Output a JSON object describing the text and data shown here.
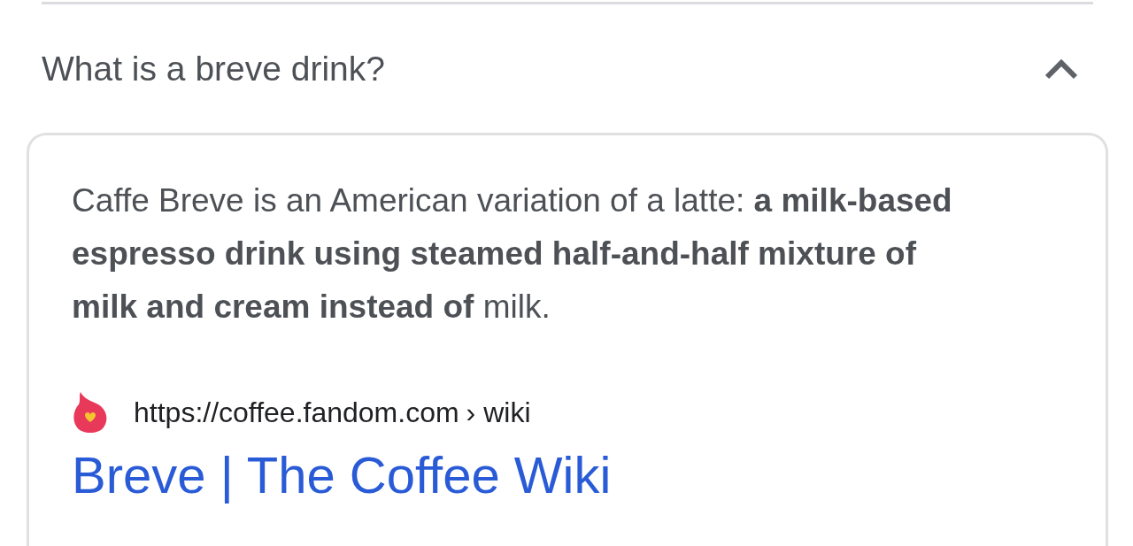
{
  "question": {
    "text": "What is a breve drink?",
    "expanded": true
  },
  "answer": {
    "snippet": "Caffe Breve is an American variation of a latte: **a milk-based espresso drink using steamed half-and-half mixture of milk and cream instead of** milk.",
    "source_url": "https://coffee.fandom.com",
    "breadcrumb": "› wiki",
    "title": "Breve | The Coffee Wiki"
  }
}
